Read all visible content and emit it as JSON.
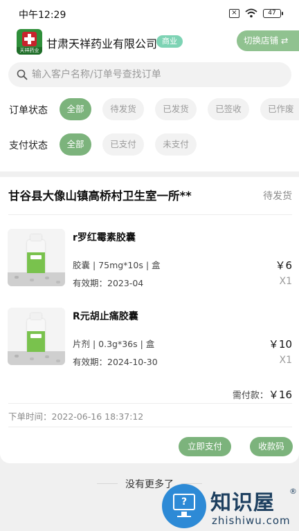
{
  "status_bar": {
    "time": "中午12:29",
    "battery": "47"
  },
  "header": {
    "logo_text": "天祥药业",
    "company_name": "甘肃天祥药业有限公司",
    "company_badge": "商业",
    "switch_store_label": "切换店铺 ⇄"
  },
  "search": {
    "placeholder": "输入客户名称/订单号查找订单"
  },
  "filters": {
    "order_status": {
      "label": "订单状态",
      "options": [
        "全部",
        "待发货",
        "已发货",
        "已签收",
        "已作废"
      ],
      "selected": "全部"
    },
    "payment_status": {
      "label": "支付状态",
      "options": [
        "全部",
        "已支付",
        "未支付"
      ],
      "selected": "全部"
    }
  },
  "order": {
    "shop_name": "甘谷县大像山镇高桥村卫生室一所**",
    "status": "待发货",
    "products": [
      {
        "name": "r罗红霉素胶囊",
        "spec": "胶囊 | 75mg*10s | 盒",
        "expiry": "有效期：2023-04",
        "price": "￥6",
        "qty": "X1"
      },
      {
        "name": "R元胡止痛胶囊",
        "spec": "片剂 | 0.3g*36s | 盒",
        "expiry": "有效期：2024-10-30",
        "price": "￥10",
        "qty": "X1"
      }
    ],
    "total_label": "需付款：",
    "total_amount": "￥16",
    "order_time": "下单时间：2022-06-16 18:37:12",
    "pay_button": "立即支付",
    "qr_button": "收款码"
  },
  "footer": {
    "no_more": "没有更多了"
  },
  "watermark": {
    "cn": "知识屋",
    "reg": "®",
    "en": "zhishiwu.com",
    "icon_glyph": "?"
  },
  "colors": {
    "accent_green": "#7cb37c",
    "badge_teal": "#7dd3b4",
    "watermark_blue": "#2d8ad6"
  }
}
